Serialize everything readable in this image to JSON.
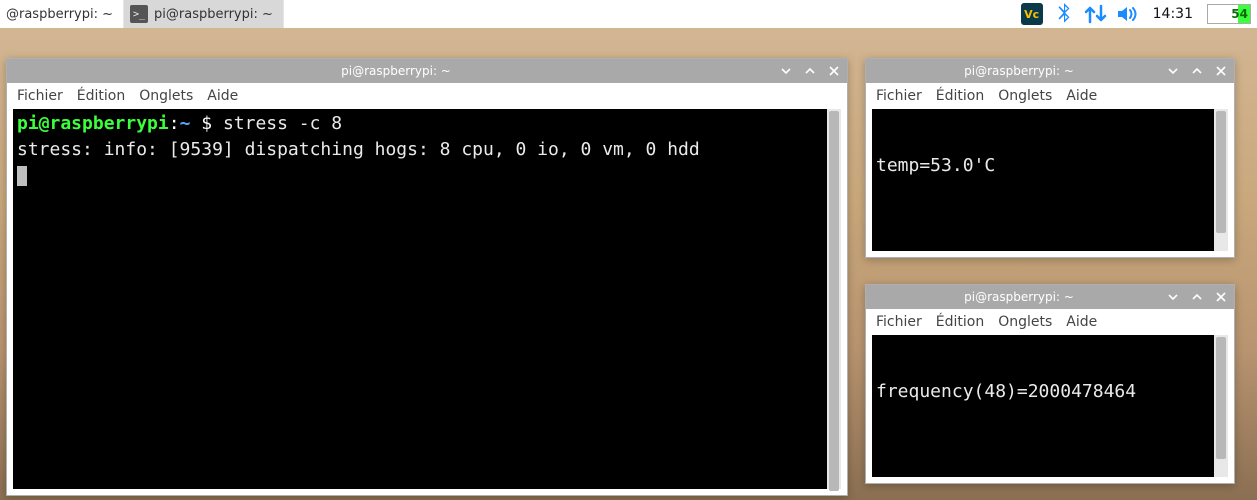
{
  "panel": {
    "task1": {
      "label": "@raspberrypi: ~"
    },
    "task2": {
      "label": "pi@raspberrypi: ~"
    },
    "clock": "14:31",
    "cpu_percent": "54"
  },
  "menus": {
    "file": "Fichier",
    "edit": "Édition",
    "tabs": "Onglets",
    "help": "Aide"
  },
  "win_main": {
    "title": "pi@raspberrypi: ~",
    "prompt_user": "pi@raspberrypi",
    "prompt_path": "~",
    "prompt_symbol": "$",
    "command": "stress -c 8",
    "output": "stress: info: [9539] dispatching hogs: 8 cpu, 0 io, 0 vm, 0 hdd"
  },
  "win_temp": {
    "title": "pi@raspberrypi: ~",
    "output": "temp=53.0'C"
  },
  "win_freq": {
    "title": "pi@raspberrypi: ~",
    "output": "frequency(48)=2000478464"
  }
}
